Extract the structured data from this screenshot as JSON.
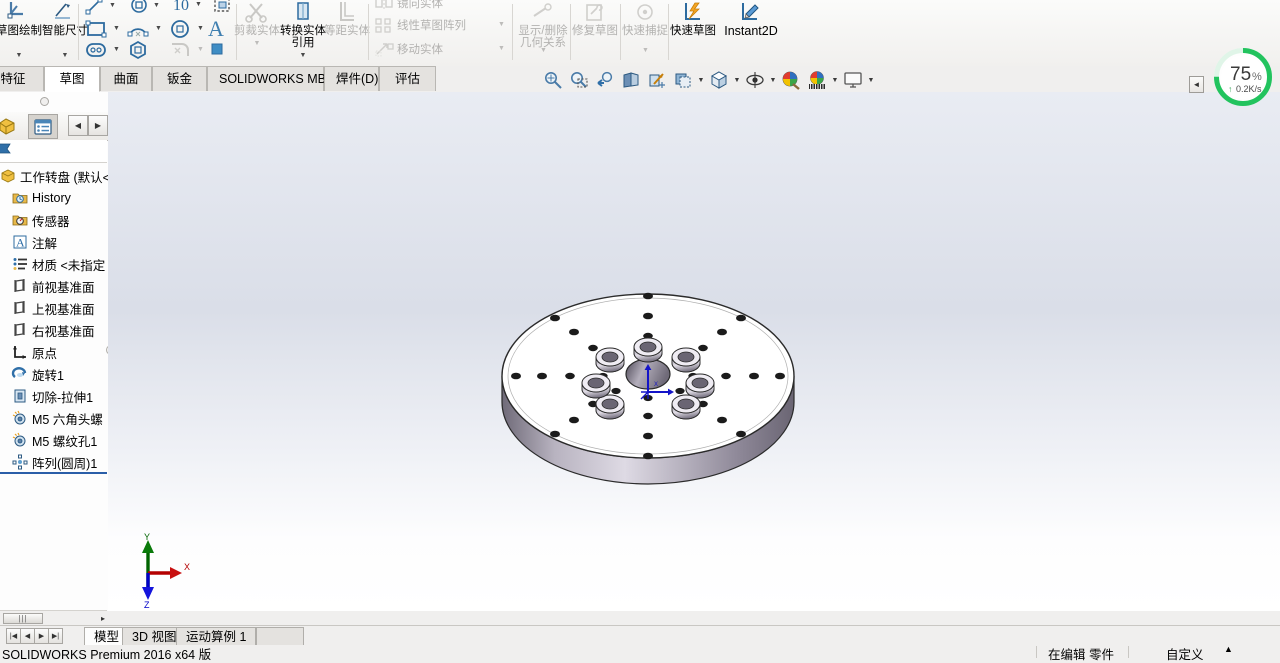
{
  "app": {
    "title": "SOLIDWORKS Premium 2016 x64 版",
    "status_edit": "在编辑 零件",
    "status_custom": "自定义",
    "status_caret": "▲"
  },
  "ribbon": {
    "groups": [
      {
        "name": "sketch-group",
        "buttons": [
          {
            "label": "草图绘制",
            "icon": "sketch-icon",
            "dim": false,
            "caret": true
          },
          {
            "label": "智能尺寸",
            "icon": "smart-dimension-icon",
            "dim": false,
            "caret": true
          }
        ]
      },
      {
        "name": "entities-group",
        "buttons": [
          {
            "label": "剪裁实体",
            "icon": "trim-entities-icon",
            "dim": true,
            "caret": true
          },
          {
            "label": "转换实体引用",
            "icon": "convert-entities-icon",
            "dim": false,
            "caret": true
          },
          {
            "label": "等距实体",
            "icon": "offset-entities-icon",
            "dim": true,
            "caret": false
          }
        ]
      },
      {
        "name": "pattern-group",
        "rows": [
          {
            "label": "镜向实体",
            "icon": "mirror-entities-icon",
            "dim": true,
            "caret": false
          },
          {
            "label": "线性草图阵列",
            "icon": "linear-sketch-pattern-icon",
            "dim": true,
            "caret": true
          },
          {
            "label": "移动实体",
            "icon": "move-entities-icon",
            "dim": true,
            "caret": true
          }
        ]
      },
      {
        "name": "relations-group",
        "buttons": [
          {
            "label": "显示/删除几何关系",
            "icon": "display-delete-relations-icon",
            "dim": true,
            "caret": true
          },
          {
            "label": "修复草图",
            "icon": "repair-sketch-icon",
            "dim": true,
            "caret": false
          },
          {
            "label": "快速捕捉",
            "icon": "quick-snaps-icon",
            "dim": true,
            "caret": true
          },
          {
            "label": "快速草图",
            "icon": "rapid-sketch-icon",
            "dim": false,
            "caret": false
          },
          {
            "label": "Instant2D",
            "icon": "instant2d-icon",
            "dim": false,
            "caret": false
          }
        ]
      }
    ]
  },
  "tabs": [
    {
      "label": "特征",
      "active": false
    },
    {
      "label": "草图",
      "active": true
    },
    {
      "label": "曲面",
      "active": false
    },
    {
      "label": "钣金",
      "active": false
    },
    {
      "label": "SOLIDWORKS MBD",
      "active": false
    },
    {
      "label": "焊件(D)",
      "active": false
    },
    {
      "label": "评估",
      "active": false
    }
  ],
  "view_toolbar": [
    {
      "icon": "zoom-to-fit-icon",
      "caret": false
    },
    {
      "icon": "zoom-to-area-icon",
      "caret": false
    },
    {
      "icon": "previous-view-icon",
      "caret": false
    },
    {
      "icon": "section-view-icon",
      "caret": false
    },
    {
      "icon": "view-orientation-icon",
      "caret": false
    },
    {
      "icon": "display-style-icon",
      "caret": true
    },
    {
      "icon": "view-cube-icon",
      "caret": true
    },
    {
      "icon": "hide-show-items-icon",
      "caret": true
    },
    {
      "icon": "edit-appearance-icon",
      "caret": false
    },
    {
      "icon": "apply-scene-icon",
      "caret": true
    },
    {
      "icon": "view-settings-icon",
      "caret": true
    }
  ],
  "left_panel": {
    "tabs": [
      {
        "icon": "feature-manager-icon",
        "selected": false
      },
      {
        "icon": "property-manager-icon",
        "selected": true
      }
    ],
    "nav": [
      {
        "icon": "nav-prev-icon",
        "glyph": "◀"
      },
      {
        "icon": "nav-next-icon",
        "glyph": "▶"
      }
    ],
    "tree": [
      {
        "label": "工作转盘  (默认<·",
        "icon": "part-icon",
        "indent": 0
      },
      {
        "label": "History",
        "icon": "history-icon",
        "indent": 1
      },
      {
        "label": "传感器",
        "icon": "sensors-icon",
        "indent": 1
      },
      {
        "label": "注解",
        "icon": "annotations-icon",
        "indent": 1
      },
      {
        "label": "材质 <未指定",
        "icon": "material-icon",
        "indent": 1
      },
      {
        "label": "前视基准面",
        "icon": "plane-icon",
        "indent": 1
      },
      {
        "label": "上视基准面",
        "icon": "plane-icon",
        "indent": 1
      },
      {
        "label": "右视基准面",
        "icon": "plane-icon",
        "indent": 1
      },
      {
        "label": "原点",
        "icon": "origin-icon",
        "indent": 1
      },
      {
        "label": "旋转1",
        "icon": "revolve-icon",
        "indent": 1
      },
      {
        "label": "切除-拉伸1",
        "icon": "extrude-cut-icon",
        "indent": 1
      },
      {
        "label": "M5 六角头螺",
        "icon": "hole-wizard-icon",
        "indent": 1
      },
      {
        "label": "M5 螺纹孔1",
        "icon": "hole-wizard-icon",
        "indent": 1
      },
      {
        "label": "阵列(圆周)1",
        "icon": "circular-pattern-icon",
        "indent": 1
      }
    ],
    "scroll_thumb_glyph": "|||",
    "scroll_right_glyph": "▸"
  },
  "doc_tabs": [
    {
      "label": "模型",
      "active": true
    },
    {
      "label": "3D 视图",
      "active": false
    },
    {
      "label": "运动算例 1",
      "active": false
    }
  ],
  "doc_nav": [
    {
      "icon": "first-tab-icon",
      "glyph": "|◀"
    },
    {
      "icon": "prev-tab-icon",
      "glyph": "◀"
    },
    {
      "icon": "next-tab-icon",
      "glyph": "▶"
    },
    {
      "icon": "last-tab-icon",
      "glyph": "▶|"
    }
  ],
  "net_widget": {
    "percent": "75",
    "percent_unit": "%",
    "speed": "0.2K/s",
    "arrow": "↑",
    "ring_color": "#22c35e",
    "ring_value": 75
  },
  "graphics": {
    "collapse_glyph": "◄",
    "triad": {
      "x_label": "X",
      "y_label": "Y",
      "z_label": "Z",
      "x_color": "#b40000",
      "y_color": "#006400",
      "z_color": "#0000c8"
    },
    "model": {
      "name": "工作转盘",
      "type": "turntable-disc",
      "top_face_color": "#ffffff",
      "side_face_color": "#8d8796",
      "edge_color": "#2b2b2b",
      "outer_hole_rings": 4,
      "spokes": 8,
      "center_counterbores": 8,
      "center_bore": 1
    }
  },
  "colors": {
    "accent": "#2a5ea8",
    "ribbon_bg": "#f1f0ee",
    "tab_active": "#ffffff",
    "disabled_text": "#b3b2b0"
  }
}
